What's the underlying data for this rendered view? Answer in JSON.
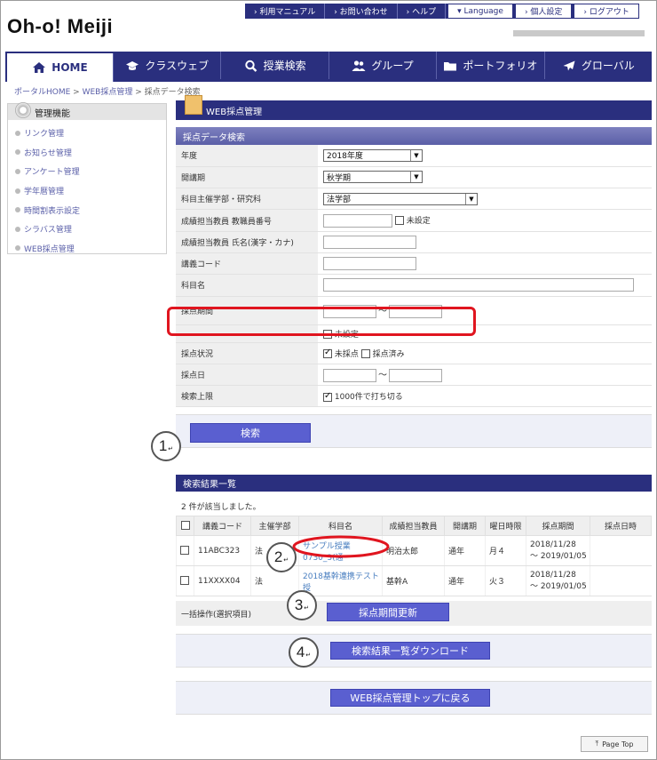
{
  "header": {
    "logo": "Oh-o! Meiji",
    "util_links": [
      "› 利用マニュアル",
      "› お問い合わせ",
      "› ヘルプ",
      "▾ Language",
      "› 個人設定",
      "› ログアウト"
    ]
  },
  "nav": {
    "items": [
      {
        "label": "HOME",
        "icon": "home-icon"
      },
      {
        "label": "クラスウェブ",
        "icon": "graduation-cap-icon"
      },
      {
        "label": "授業検索",
        "icon": "search-icon"
      },
      {
        "label": "グループ",
        "icon": "group-icon"
      },
      {
        "label": "ポートフォリオ",
        "icon": "folder-icon"
      },
      {
        "label": "グローバル",
        "icon": "airplane-icon"
      }
    ]
  },
  "breadcrumb": {
    "portal": "ポータルHOME",
    "sep": " > ",
    "web": "WEB採点管理",
    "current": "採点データ検索"
  },
  "sidebar": {
    "title": "管理機能",
    "items": [
      "リンク管理",
      "お知らせ管理",
      "アンケート管理",
      "学年暦管理",
      "時間割表示設定",
      "シラバス管理",
      "WEB採点管理"
    ]
  },
  "main": {
    "title": "WEB採点管理",
    "section": "採点データ検索",
    "fields": {
      "year_label": "年度",
      "year_value": "2018年度",
      "term_label": "開講期",
      "term_value": "秋学期",
      "dept_label": "科目主催学部・研究科",
      "dept_value": "法学部",
      "teacher_no_label": "成績担当教員 教職員番号",
      "unset_label": "未設定",
      "teacher_name_label": "成績担当教員 氏名(漢字・カナ)",
      "course_code_label": "講義コード",
      "subject_label": "科目名",
      "period_label": "採点期間",
      "tilde": "〜",
      "period_unset": "未設定",
      "status_label": "採点状況",
      "status_unscored": "未採点",
      "status_scored": "採点済み",
      "date_label": "採点日",
      "limit_label": "検索上限",
      "limit_value": "1000件で打ち切る"
    },
    "search_button": "検索"
  },
  "results": {
    "title": "検索結果一覧",
    "count": "2 件が該当しました。",
    "columns": [
      "講義コード",
      "主催学部",
      "科目名",
      "成績担当教員",
      "開講期",
      "曜日時限",
      "採点期間",
      "採点日時"
    ],
    "rows": [
      {
        "code": "11ABC323",
        "dept": "法",
        "subject": "サンプル授業0730_3(通",
        "teacher": "明治太郎",
        "term": "通年",
        "slot": "月４",
        "period1": "2018/11/28",
        "period2": "〜 2019/01/05",
        "date": ""
      },
      {
        "code": "11XXXX04",
        "dept": "法",
        "subject": "2018基幹連携テスト授",
        "teacher": "基幹A",
        "term": "通年",
        "slot": "火３",
        "period1": "2018/11/28",
        "period2": "〜 2019/01/05",
        "date": ""
      }
    ],
    "bulk_label": "一括操作(選択項目)",
    "update_button": "採点期間更新",
    "download_button": "検索結果一覧ダウンロード",
    "back_button": "WEB採点管理トップに戻る"
  },
  "steps": [
    "1",
    "2",
    "3",
    "4"
  ],
  "return_mark": "↵",
  "page_top": "Page Top",
  "colors": {
    "brand": "#2a2f7e",
    "button": "#5a5fd0",
    "highlight": "#e0151f"
  }
}
